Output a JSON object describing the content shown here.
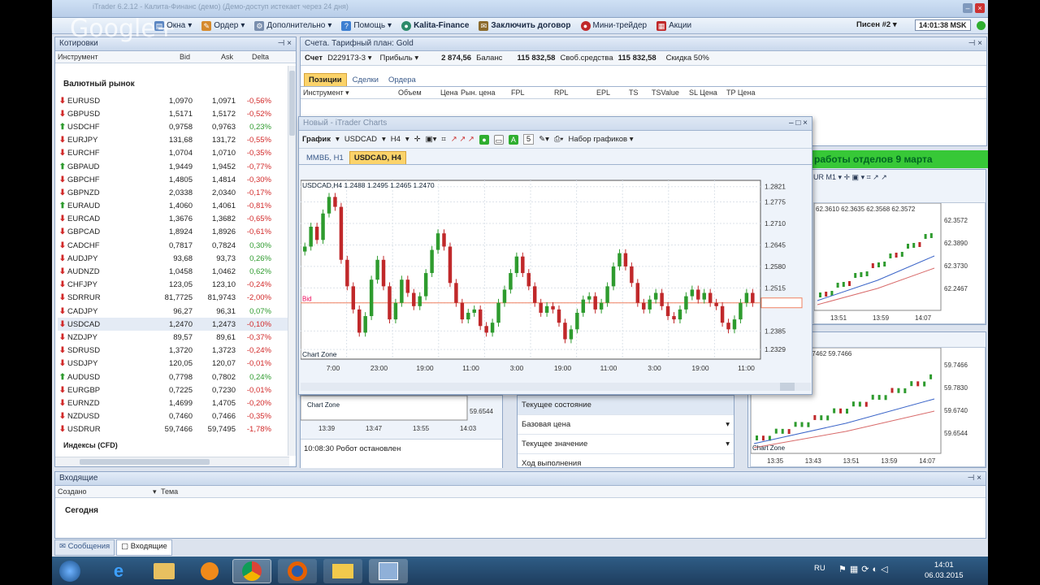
{
  "window": {
    "title": "iTrader 6.2.12 - Калита-Финанс (демо) (Демо-доступ истекает через 24 дня)"
  },
  "watermark": "Google+",
  "menu": {
    "items": [
      "Окна",
      "Ордер",
      "Дополнительно",
      "Помощь",
      "Kalita-Finance",
      "Заключить договор",
      "Мини-трейдер",
      "Акции"
    ],
    "user": "Писен #2",
    "clock": "14:01:38 MSK"
  },
  "quotes": {
    "title": "Котировки",
    "headers": [
      "Инструмент",
      "Bid",
      "Ask",
      "Delta"
    ],
    "section": "Валютный рынок",
    "rows": [
      {
        "dir": "dn",
        "sym": "EURUSD",
        "bid": "1,0970",
        "ask": "1,0971",
        "delta": "-0,56%"
      },
      {
        "dir": "dn",
        "sym": "GBPUSD",
        "bid": "1,5171",
        "ask": "1,5172",
        "delta": "-0,52%"
      },
      {
        "dir": "up",
        "sym": "USDCHF",
        "bid": "0,9758",
        "ask": "0,9763",
        "delta": "0,23%"
      },
      {
        "dir": "dn",
        "sym": "EURJPY",
        "bid": "131,68",
        "ask": "131,72",
        "delta": "-0,55%"
      },
      {
        "dir": "dn",
        "sym": "EURCHF",
        "bid": "1,0704",
        "ask": "1,0710",
        "delta": "-0,35%"
      },
      {
        "dir": "up",
        "sym": "GBPAUD",
        "bid": "1,9449",
        "ask": "1,9452",
        "delta": "-0,77%"
      },
      {
        "dir": "dn",
        "sym": "GBPCHF",
        "bid": "1,4805",
        "ask": "1,4814",
        "delta": "-0,30%"
      },
      {
        "dir": "dn",
        "sym": "GBPNZD",
        "bid": "2,0338",
        "ask": "2,0340",
        "delta": "-0,17%"
      },
      {
        "dir": "up",
        "sym": "EURAUD",
        "bid": "1,4060",
        "ask": "1,4061",
        "delta": "-0,81%"
      },
      {
        "dir": "dn",
        "sym": "EURCAD",
        "bid": "1,3676",
        "ask": "1,3682",
        "delta": "-0,65%"
      },
      {
        "dir": "dn",
        "sym": "GBPCAD",
        "bid": "1,8924",
        "ask": "1,8926",
        "delta": "-0,61%"
      },
      {
        "dir": "dn",
        "sym": "CADCHF",
        "bid": "0,7817",
        "ask": "0,7824",
        "delta": "0,30%"
      },
      {
        "dir": "dn",
        "sym": "AUDJPY",
        "bid": "93,68",
        "ask": "93,73",
        "delta": "0,26%"
      },
      {
        "dir": "dn",
        "sym": "AUDNZD",
        "bid": "1,0458",
        "ask": "1,0462",
        "delta": "0,62%"
      },
      {
        "dir": "dn",
        "sym": "CHFJPY",
        "bid": "123,05",
        "ask": "123,10",
        "delta": "-0,24%"
      },
      {
        "dir": "dn",
        "sym": "SDRRUR",
        "bid": "81,7725",
        "ask": "81,9743",
        "delta": "-2,00%"
      },
      {
        "dir": "dn",
        "sym": "CADJPY",
        "bid": "96,27",
        "ask": "96,31",
        "delta": "0,07%"
      },
      {
        "dir": "dn",
        "sym": "USDCAD",
        "bid": "1,2470",
        "ask": "1,2473",
        "delta": "-0,10%"
      },
      {
        "dir": "dn",
        "sym": "NZDJPY",
        "bid": "89,57",
        "ask": "89,61",
        "delta": "-0,37%"
      },
      {
        "dir": "dn",
        "sym": "SDRUSD",
        "bid": "1,3720",
        "ask": "1,3723",
        "delta": "-0,24%"
      },
      {
        "dir": "dn",
        "sym": "USDJPY",
        "bid": "120,05",
        "ask": "120,07",
        "delta": "-0,01%"
      },
      {
        "dir": "up",
        "sym": "AUDUSD",
        "bid": "0,7798",
        "ask": "0,7802",
        "delta": "0,24%"
      },
      {
        "dir": "dn",
        "sym": "EURGBP",
        "bid": "0,7225",
        "ask": "0,7230",
        "delta": "-0,01%"
      },
      {
        "dir": "dn",
        "sym": "EURNZD",
        "bid": "1,4699",
        "ask": "1,4705",
        "delta": "-0,20%"
      },
      {
        "dir": "dn",
        "sym": "NZDUSD",
        "bid": "0,7460",
        "ask": "0,7466",
        "delta": "-0,35%"
      },
      {
        "dir": "dn",
        "sym": "USDRUR",
        "bid": "59,7466",
        "ask": "59,7495",
        "delta": "-1,78%"
      }
    ],
    "next_section": "Индексы (CFD)"
  },
  "account": {
    "title": "Счета. Тарифный план: Gold",
    "fields": {
      "acc_label": "Счет",
      "acc_val": "D229173-3",
      "profit_label": "Прибыль",
      "profit_val": "2 874,56",
      "bal_label": "Баланс",
      "bal_val": "115 832,58",
      "free_label": "Своб.средства",
      "free_val": "115 832,58",
      "discount": "Скидка 50%"
    },
    "tabs": [
      "Позиции",
      "Сделки",
      "Ордера"
    ],
    "headers": [
      "Инструмент",
      "Объем",
      "Цена",
      "Рын. цена",
      "FPL",
      "RPL",
      "EPL",
      "TS",
      "TSValue",
      "SL Цена",
      "TP Цена"
    ]
  },
  "chartwin": {
    "title": "Новый - iTrader Charts",
    "toolbar": {
      "chart": "График",
      "symbol": "USDCAD",
      "tf": "H4",
      "count": "5",
      "sets": "Набор графиков"
    },
    "tabs": [
      "ММВБ, H1",
      "USDCAD, H4"
    ],
    "ohlc": "USDCAD,H4  1.2488  1.2495  1.2465  1.2470",
    "bid_label": "Bid",
    "zone": "Chart Zone"
  },
  "chart_data": {
    "type": "candlestick",
    "symbol": "USDCAD",
    "timeframe": "H4",
    "ylim": [
      1.23,
      1.284
    ],
    "yticks": [
      "1.2821",
      "1.2775",
      "1.2710",
      "1.2645",
      "1.2580",
      "1.2515",
      "1.2470",
      "1.2385",
      "1.2329"
    ],
    "xticks": [
      "7:00",
      "23:00",
      "19:00",
      "11:00",
      "3:00",
      "19:00",
      "11:00",
      "3:00",
      "19:00",
      "11:00"
    ],
    "closes": [
      1.264,
      1.27,
      1.266,
      1.274,
      1.279,
      1.276,
      1.26,
      1.252,
      1.245,
      1.238,
      1.243,
      1.254,
      1.26,
      1.252,
      1.242,
      1.247,
      1.254,
      1.25,
      1.246,
      1.249,
      1.256,
      1.263,
      1.268,
      1.264,
      1.253,
      1.247,
      1.242,
      1.244,
      1.245,
      1.24,
      1.238,
      1.241,
      1.247,
      1.251,
      1.256,
      1.261,
      1.256,
      1.252,
      1.247,
      1.244,
      1.246,
      1.245,
      1.241,
      1.236,
      1.239,
      1.244,
      1.248,
      1.249,
      1.245,
      1.247,
      1.252,
      1.258,
      1.262,
      1.258,
      1.253,
      1.247,
      1.245,
      1.248,
      1.25,
      1.246,
      1.243,
      1.242,
      1.245,
      1.249,
      1.251,
      1.248,
      1.25,
      1.247,
      1.246,
      1.241,
      1.239,
      1.242,
      1.247,
      1.25,
      1.247
    ]
  },
  "banner": "работы отделов 9 марта",
  "mini1": {
    "prices": [
      "62.3610",
      "62.3635",
      "62.3568",
      "62.3572",
      "62.3572",
      "62.3890",
      "62.3730",
      "62.2467"
    ],
    "times": [
      "13:51",
      "13:59",
      "14:07"
    ]
  },
  "mini2": {
    "prices": [
      "59.7476",
      "59.7476",
      "59.7462",
      "59.7466",
      "59.7466",
      "59.7830",
      "59.6740",
      "59.6544"
    ],
    "times": [
      "13:35",
      "13:43",
      "13:51",
      "13:59",
      "14:07"
    ],
    "zone": "Chart Zone"
  },
  "mini3": {
    "times": [
      "13:39",
      "13:47",
      "13:55",
      "14:03"
    ],
    "price": "59.6544",
    "zone": "Chart Zone"
  },
  "log": {
    "line": "10:08:30 Робот остановлен"
  },
  "props": [
    "Текущее состояние",
    "Базовая цена",
    "Текущее значение",
    "Ход выполнения"
  ],
  "inbox": {
    "title": "Входящие",
    "headers": [
      "Создано",
      "Тема"
    ],
    "today": "Сегодня",
    "tabs": [
      "Сообщения",
      "Входящие"
    ]
  },
  "taskbar": {
    "lang": "RU",
    "time": "14:01",
    "date": "06.03.2015"
  }
}
